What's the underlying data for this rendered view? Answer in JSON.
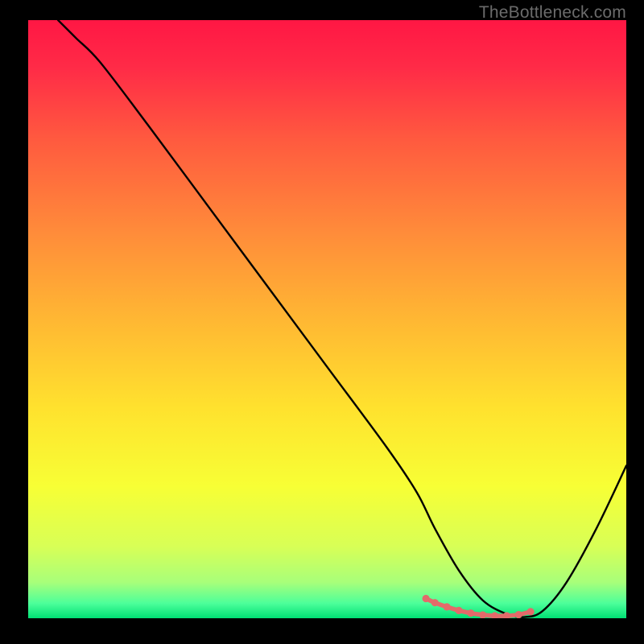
{
  "watermark": "TheBottleneck.com",
  "gradient_stops": [
    {
      "offset": 0.0,
      "color": "#ff1744"
    },
    {
      "offset": 0.08,
      "color": "#ff2b47"
    },
    {
      "offset": 0.2,
      "color": "#ff5a3f"
    },
    {
      "offset": 0.35,
      "color": "#ff8a3a"
    },
    {
      "offset": 0.5,
      "color": "#ffb733"
    },
    {
      "offset": 0.65,
      "color": "#ffe22e"
    },
    {
      "offset": 0.78,
      "color": "#f7ff35"
    },
    {
      "offset": 0.88,
      "color": "#d8ff56"
    },
    {
      "offset": 0.94,
      "color": "#a8ff7a"
    },
    {
      "offset": 0.975,
      "color": "#4dff9a"
    },
    {
      "offset": 1.0,
      "color": "#00e074"
    }
  ],
  "chart_data": {
    "type": "line",
    "title": "",
    "xlabel": "",
    "ylabel": "",
    "xlim": [
      0,
      100
    ],
    "ylim": [
      0,
      100
    ],
    "series": [
      {
        "name": "curve",
        "color": "#000000",
        "x": [
          5,
          8,
          12,
          20,
          30,
          40,
          50,
          60,
          65,
          68,
          72,
          76,
          80,
          83,
          86,
          90,
          95,
          100
        ],
        "y": [
          100,
          97,
          93,
          82.5,
          69,
          55.5,
          42,
          28.5,
          21,
          15,
          8,
          3,
          0.7,
          0.2,
          1.2,
          6,
          15,
          25.5
        ]
      }
    ],
    "highlight": {
      "name": "flat-region",
      "color": "#e36a6a",
      "points_x": [
        66.5,
        68,
        70,
        72,
        74,
        76,
        78,
        80,
        82,
        84
      ],
      "points_y": [
        3.3,
        2.6,
        1.9,
        1.3,
        0.85,
        0.55,
        0.4,
        0.4,
        0.6,
        1.1
      ]
    }
  }
}
